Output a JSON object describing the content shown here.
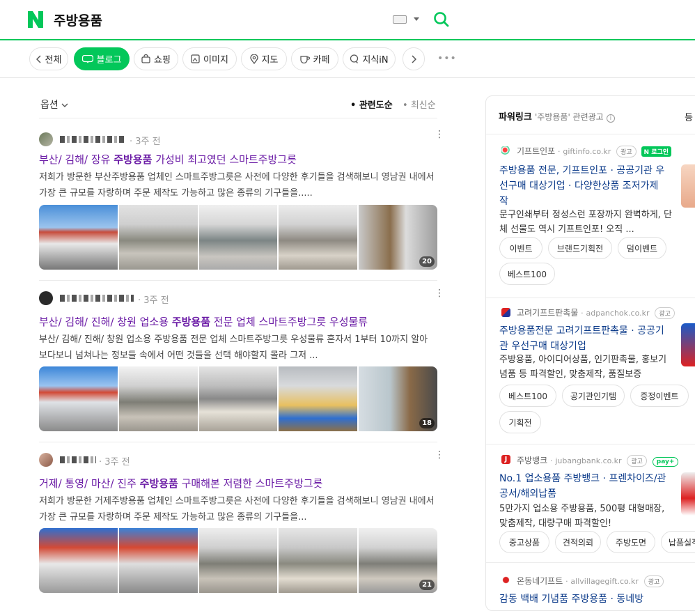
{
  "header": {
    "query": "주방용품"
  },
  "tabs": [
    {
      "label": "전체",
      "icon": "chevron-left-icon"
    },
    {
      "label": "블로그",
      "icon": "blog-icon"
    },
    {
      "label": "쇼핑",
      "icon": "shopping-bag-icon"
    },
    {
      "label": "이미지",
      "icon": "image-icon"
    },
    {
      "label": "지도",
      "icon": "map-pin-icon"
    },
    {
      "label": "카페",
      "icon": "cafe-cup-icon"
    },
    {
      "label": "지식iN",
      "icon": "knowledge-icon"
    }
  ],
  "toolbar": {
    "options_label": "옵션",
    "sort_relevance": "관련도순",
    "sort_latest": "최신순"
  },
  "posts": [
    {
      "ago": "3주 전",
      "title_pre": "부산/ 김해/ 장유 ",
      "title_key": "주방용품",
      "title_post": " 가성비 최고였던 스마트주방그릇",
      "desc": "저희가 방문한 부산주방용품 업체인 스마트주방그릇은 사전에 다양한 후기들을 검색해보니 영남권 내에서 가장 큰 규모를 자랑하며 주문 제작도 가능하고 많은 종류의 기구들을.....",
      "image_count": "20"
    },
    {
      "ago": "3주 전",
      "title_pre": "부산/ 김해/ 진해/ 창원 업소용 ",
      "title_key": "주방용품",
      "title_post": " 전문 업체 스마트주방그릇 우성물류",
      "desc": "부산/ 김해/ 진해/ 창원 업소용 주방용품 전문 업체 스마트주방그릇 우성물류 혼자서 1부터 10까지 알아보다보니 넘쳐나는 정보들 속에서 어떤 것들을 선택 해야할지 몰라 그저 ...",
      "image_count": "18"
    },
    {
      "ago": "3주 전",
      "title_pre": "거제/ 통영/ 마산/ 진주 ",
      "title_key": "주방용품",
      "title_post": " 구매해본 저렴한 스마트주방그릇",
      "desc": "저희가 방문한 거제주방용품 업체인 스마트주방그릇은 사전에 다양한 후기들을 검색해보니 영남권 내에서 가장 큰 규모를 자랑하며 주문 제작도 가능하고 많은 종류의 기구들을...",
      "image_count": "21"
    }
  ],
  "powerlink": {
    "label": "파워링크",
    "subtitle": "'주방용품' 관련광고",
    "more": "등",
    "ads": [
      {
        "site": "기프트인포",
        "url": "giftinfo.co.kr",
        "badge": "광고",
        "extra": "N 로그인",
        "title": "주방용품 전문, 기프트인포 · 공공기관 우선구매 대상기업 · 다양한상품 조저가제작",
        "desc": "문구인쇄부터 정성스런 포장까지 완벽하게, 단체 선물도 역시 기프트인포! 오직 ...",
        "chips": [
          "이벤트",
          "브랜드기획전",
          "덤이벤트",
          "베스트100"
        ]
      },
      {
        "site": "고려기프트판촉물",
        "url": "adpanchok.co.kr",
        "badge": "광고",
        "title": "주방용품전문 고려기프트판촉물 · 공공기관 우선구매 대상기업",
        "desc": "주방용품, 아이디어상품, 인기판촉물, 홍보기념품 등 파격할인, 맞춤제작, 품질보증",
        "chips": [
          "베스트100",
          "공기관인기템",
          "증정이벤트",
          "기획전"
        ]
      },
      {
        "site": "주방뱅크",
        "url": "jubangbank.co.kr",
        "badge": "광고",
        "extra": "pay+",
        "title": "No.1 업소용품 주방뱅크 · 프렌차이즈/관공서/해외납품",
        "desc": "5만가지 업소용 주방용품, 500평 대형매장, 맞춤제작, 대량구매 파격할인!",
        "chips": [
          "중고상품",
          "견적의뢰",
          "주방도면",
          "납품실적"
        ]
      },
      {
        "site": "온동네기프트",
        "url": "allvillagegift.co.kr",
        "badge": "광고",
        "title": "감동 백배 기념품 주방용품 · 동네방"
      }
    ]
  },
  "colors": {
    "brand_green": "#03c75a",
    "title_purple": "#6b1ca6",
    "ad_title_blue": "#0c3b8a"
  }
}
